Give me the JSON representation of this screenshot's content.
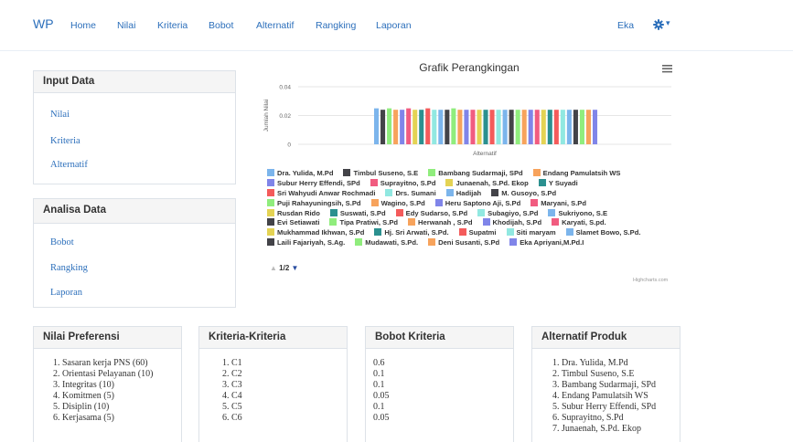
{
  "navbar": {
    "brand": "WP",
    "items": [
      "Home",
      "Nilai",
      "Kriteria",
      "Bobot",
      "Alternatif",
      "Rangking",
      "Laporan"
    ],
    "user": "Eka",
    "settings_icon": "gear-icon",
    "settings_caret": "▾",
    "accent": "#2c6fbb"
  },
  "input_panel": {
    "title": "Input Data",
    "links": [
      "Nilai",
      "Kriteria",
      "Alternatif"
    ]
  },
  "analisa_panel": {
    "title": "Analisa Data",
    "links": [
      "Bobot",
      "Rangking",
      "Laporan"
    ]
  },
  "chart_data": {
    "type": "bar",
    "title": "Grafik Perangkingan",
    "xlabel": "Alternatif",
    "ylabel": "Jumlah Nilai",
    "ylim": [
      0,
      0.04
    ],
    "yticks": [
      "0",
      "0.02",
      "0.04"
    ],
    "grid": true,
    "legend_position": "bottom",
    "series": [
      {
        "name": "Dra. Yulida, M.Pd",
        "value": 0.025,
        "color": "#7cb5ec"
      },
      {
        "name": "Timbul Suseno, S.E",
        "value": 0.024,
        "color": "#434348"
      },
      {
        "name": "Bambang Sudarmaji, SPd",
        "value": 0.025,
        "color": "#90ed7d"
      },
      {
        "name": "Endang Pamulatsih WS",
        "value": 0.024,
        "color": "#f7a35c"
      },
      {
        "name": "Subur Herry Effendi, SPd",
        "value": 0.024,
        "color": "#8085e9"
      },
      {
        "name": "Suprayitno, S.Pd",
        "value": 0.025,
        "color": "#f15c80"
      },
      {
        "name": "Junaenah, S.Pd. Ekop",
        "value": 0.024,
        "color": "#e4d354"
      },
      {
        "name": "Y Suyadi",
        "value": 0.024,
        "color": "#2b908f"
      },
      {
        "name": "Sri Wahyudi Anwar Rochmadi",
        "value": 0.025,
        "color": "#f45b5b"
      },
      {
        "name": "Drs. Sumani",
        "value": 0.024,
        "color": "#91e8e1"
      },
      {
        "name": "Hadijah",
        "value": 0.024,
        "color": "#7cb5ec"
      },
      {
        "name": "M. Gusoyo, S.Pd",
        "value": 0.024,
        "color": "#434348"
      },
      {
        "name": "Puji Rahayuningsih, S.Pd",
        "value": 0.025,
        "color": "#90ed7d"
      },
      {
        "name": "Wagino, S.Pd",
        "value": 0.024,
        "color": "#f7a35c"
      },
      {
        "name": "Heru Saptono Aji, S.Pd",
        "value": 0.024,
        "color": "#8085e9"
      },
      {
        "name": "Maryani, S.Pd",
        "value": 0.024,
        "color": "#f15c80"
      },
      {
        "name": "Rusdan Rido",
        "value": 0.024,
        "color": "#e4d354"
      },
      {
        "name": "Suswati, S.Pd",
        "value": 0.024,
        "color": "#2b908f"
      },
      {
        "name": "Edy Sudarso, S.Pd",
        "value": 0.024,
        "color": "#f45b5b"
      },
      {
        "name": "Subagiyo, S.Pd",
        "value": 0.024,
        "color": "#91e8e1"
      },
      {
        "name": "Sukriyono, S.E",
        "value": 0.024,
        "color": "#7cb5ec"
      },
      {
        "name": "Evi Setiawati",
        "value": 0.024,
        "color": "#434348"
      },
      {
        "name": "Tipa Pratiwi, S.Pd",
        "value": 0.024,
        "color": "#90ed7d"
      },
      {
        "name": "Herwanah , S.Pd",
        "value": 0.024,
        "color": "#f7a35c"
      },
      {
        "name": "Khodijah, S.Pd",
        "value": 0.024,
        "color": "#8085e9"
      },
      {
        "name": "Karyati, S.pd.",
        "value": 0.024,
        "color": "#f15c80"
      },
      {
        "name": "Mukhammad Ikhwan, S.Pd",
        "value": 0.024,
        "color": "#e4d354"
      },
      {
        "name": "Hj. Sri Arwati, S.Pd.",
        "value": 0.024,
        "color": "#2b908f"
      },
      {
        "name": "Supatmi",
        "value": 0.024,
        "color": "#f45b5b"
      },
      {
        "name": "Siti maryam",
        "value": 0.024,
        "color": "#91e8e1"
      },
      {
        "name": "Slamet Bowo, S.Pd.",
        "value": 0.024,
        "color": "#7cb5ec"
      },
      {
        "name": "Laili Fajariyah, S.Ag.",
        "value": 0.024,
        "color": "#434348"
      },
      {
        "name": "Mudawati, S.Pd.",
        "value": 0.024,
        "color": "#90ed7d"
      },
      {
        "name": "Deni Susanti, S.Pd",
        "value": 0.024,
        "color": "#f7a35c"
      },
      {
        "name": "Eka Apriyani,M.Pd.I",
        "value": 0.024,
        "color": "#8085e9"
      }
    ],
    "legend_rows": [
      [
        0,
        1,
        2,
        3
      ],
      [
        4,
        5,
        6,
        7
      ],
      [
        8,
        9,
        10,
        11
      ],
      [
        12,
        13,
        14,
        15
      ],
      [
        16,
        17,
        18,
        19,
        20
      ],
      [
        21,
        22,
        23,
        24,
        25
      ],
      [
        26,
        27,
        28,
        29,
        30
      ],
      [
        31,
        32,
        33,
        34
      ]
    ],
    "pager": "1/2",
    "credits": "Highcharts.com"
  },
  "nilai_preferensi": {
    "title": "Nilai Preferensi",
    "items": [
      "1. Sasaran kerja PNS (60)",
      "2. Orientasi Pelayanan (10)",
      "3. Integritas (10)",
      "4. Komitmen (5)",
      "5. Disiplin (10)",
      "6. Kerjasama (5)"
    ]
  },
  "kriteria": {
    "title": "Kriteria-Kriteria",
    "items": [
      "1. C1",
      "2. C2",
      "3. C3",
      "4. C4",
      "5. C5",
      "6. C6"
    ]
  },
  "bobot": {
    "title": "Bobot Kriteria",
    "items": [
      "0.6",
      "0.1",
      "0.1",
      "0.05",
      "0.1",
      "0.05"
    ]
  },
  "alternatif": {
    "title": "Alternatif Produk",
    "items": [
      "1. Dra. Yulida, M.Pd",
      "2. Timbul Suseno, S.E",
      "3. Bambang Sudarmaji, SPd",
      "4. Endang Pamulatsih WS",
      "5. Subur Herry Effendi, SPd",
      "6. Suprayitno, S.Pd",
      "7. Junaenah, S.Pd. Ekop"
    ]
  }
}
